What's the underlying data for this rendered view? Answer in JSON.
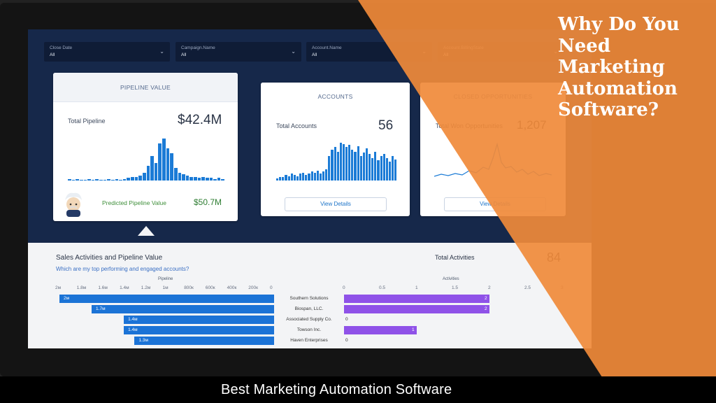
{
  "headline": "Why Do You Need Marketing Automation Software?",
  "caption": "Best Marketing Automation Software",
  "colors": {
    "accent_orange": "#f08a3a",
    "bar_blue": "#1b7bd6",
    "bar_purple": "#8f52e8",
    "dashboard_navy": "#16284a"
  },
  "filters": [
    {
      "label": "Close Date",
      "value": "All"
    },
    {
      "label": "Campaign.Name",
      "value": "All"
    },
    {
      "label": "Account.Name",
      "value": "All"
    },
    {
      "label": "Account.BillingState",
      "value": "All"
    }
  ],
  "pipeline_card": {
    "title": "PIPELINE VALUE",
    "total_label": "Total Pipeline",
    "total_value": "$42.4M",
    "predicted_label": "Predicted Pipeline Value",
    "predicted_value": "$50.7M",
    "sparkline": [
      1,
      0,
      1,
      0,
      0,
      1,
      0,
      1,
      0,
      0,
      1,
      0,
      1,
      0,
      1,
      2,
      3,
      3,
      4,
      6,
      12,
      20,
      14,
      30,
      34,
      26,
      22,
      10,
      6,
      5,
      4,
      3,
      3,
      2,
      3,
      2,
      2,
      1,
      2,
      1
    ]
  },
  "accounts_card": {
    "title": "ACCOUNTS",
    "total_label": "Total Accounts",
    "total_value": "56",
    "button": "View Details",
    "sparkline": [
      2,
      3,
      3,
      5,
      4,
      6,
      5,
      4,
      6,
      7,
      5,
      6,
      8,
      7,
      9,
      6,
      8,
      10,
      22,
      28,
      30,
      26,
      34,
      33,
      30,
      32,
      28,
      26,
      31,
      22,
      25,
      29,
      24,
      20,
      26,
      18,
      22,
      24,
      20,
      17,
      22,
      19
    ]
  },
  "closed_card": {
    "title": "CLOSED OPPORTUNITIES",
    "total_label": "Total Won Opportunities",
    "total_value": "1,207",
    "button": "View Details"
  },
  "sales_section": {
    "title": "Sales Activities and Pipeline Value",
    "subtitle": "Which are my top performing and engaged accounts?",
    "pipeline_axis_label": "Pipeline",
    "pipeline_ticks": [
      "2м",
      "1.8м",
      "1.6м",
      "1.4м",
      "1.2м",
      "1м",
      "800к",
      "600к",
      "400к",
      "200к",
      "0"
    ],
    "activities_axis_label": "Activities",
    "activities_ticks": [
      "0",
      "0.5",
      "1",
      "1.5",
      "2",
      "2.5",
      "3"
    ],
    "total_activities_label": "Total Activities",
    "total_activities_value": "84"
  },
  "chart_data": {
    "type": "bar",
    "categories": [
      "Southern Solutions",
      "Biospan, LLC.",
      "Associated Supply Co.",
      "Towson Inc.",
      "Haven Enterprises"
    ],
    "series": [
      {
        "name": "Pipeline",
        "values": [
          2.0,
          1.7,
          1.4,
          1.4,
          1.3
        ],
        "labels": [
          "2м",
          "1.7м",
          "1.4м",
          "1.4м",
          "1.3м"
        ]
      },
      {
        "name": "Activities",
        "values": [
          2,
          2,
          0,
          1,
          0
        ]
      }
    ],
    "pipeline_xlim": [
      0,
      2.0
    ],
    "activities_xlim": [
      0,
      3
    ]
  }
}
